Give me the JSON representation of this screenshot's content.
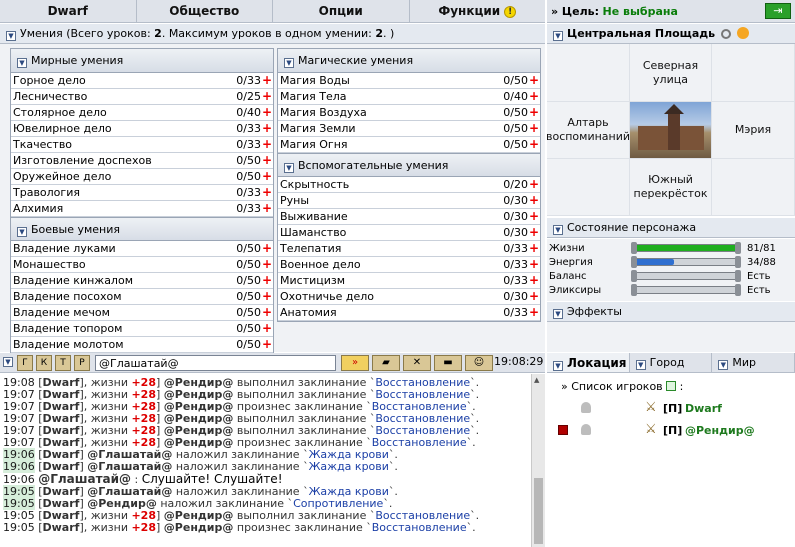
{
  "topbar": {
    "items": [
      "Dwarf",
      "Общество",
      "Опции",
      "Функции"
    ]
  },
  "goal": {
    "label": "» Цель:",
    "value": "Не выбрана"
  },
  "skills": {
    "header_prefix": "Умения (Всего уроков: ",
    "total": "2",
    "header_mid": ". Максимум уроков в одном умении: ",
    "max": "2",
    "header_suffix": ". )",
    "peace": {
      "title": "Мирные умения",
      "rows": [
        {
          "name": "Горное дело",
          "val": "0/33"
        },
        {
          "name": "Лесничество",
          "val": "0/25"
        },
        {
          "name": "Столярное дело",
          "val": "0/40"
        },
        {
          "name": "Ювелирное дело",
          "val": "0/33"
        },
        {
          "name": "Ткачество",
          "val": "0/33"
        },
        {
          "name": "Изготовление доспехов",
          "val": "0/50"
        },
        {
          "name": "Оружейное дело",
          "val": "0/50"
        },
        {
          "name": "Травология",
          "val": "0/33"
        },
        {
          "name": "Алхимия",
          "val": "0/33"
        }
      ]
    },
    "combat": {
      "title": "Боевые умения",
      "rows": [
        {
          "name": "Владение луками",
          "val": "0/50"
        },
        {
          "name": "Монашество",
          "val": "0/50"
        },
        {
          "name": "Владение кинжалом",
          "val": "0/50"
        },
        {
          "name": "Владение посохом",
          "val": "0/50"
        },
        {
          "name": "Владение мечом",
          "val": "0/50"
        },
        {
          "name": "Владение топором",
          "val": "0/50"
        },
        {
          "name": "Владение молотом",
          "val": "0/50"
        }
      ]
    },
    "magic": {
      "title": "Магические умения",
      "rows": [
        {
          "name": "Магия Воды",
          "val": "0/50"
        },
        {
          "name": "Магия Тела",
          "val": "0/40"
        },
        {
          "name": "Магия Воздуха",
          "val": "0/50"
        },
        {
          "name": "Магия Земли",
          "val": "0/50"
        },
        {
          "name": "Магия Огня",
          "val": "0/50"
        }
      ]
    },
    "aux": {
      "title": "Вспомогательные умения",
      "rows": [
        {
          "name": "Скрытность",
          "val": "0/20"
        },
        {
          "name": "Руны",
          "val": "0/30"
        },
        {
          "name": "Выживание",
          "val": "0/30"
        },
        {
          "name": "Шаманство",
          "val": "0/30"
        },
        {
          "name": "Телепатия",
          "val": "0/33"
        },
        {
          "name": "Военное дело",
          "val": "0/33"
        },
        {
          "name": "Мистицизм",
          "val": "0/33"
        },
        {
          "name": "Охотничье дело",
          "val": "0/30"
        },
        {
          "name": "Анатомия",
          "val": "0/33"
        }
      ]
    }
  },
  "location": {
    "title": "Центральная Площадь",
    "north": "Северная улица",
    "west": "Алтарь воспоминаний",
    "east": "Мэрия",
    "south": "Южный перекрёсток"
  },
  "state": {
    "title": "Состояние персонажа",
    "rows": [
      {
        "label": "Жизни",
        "value": "81/81",
        "fill": 1.0,
        "color": "#1fae1f"
      },
      {
        "label": "Энергия",
        "value": "34/88",
        "fill": 0.386,
        "color": "#2f6fd0"
      },
      {
        "label": "Баланс",
        "value": "Есть",
        "fill": 0.0,
        "color": "#999999"
      },
      {
        "label": "Эликсиры",
        "value": "Есть",
        "fill": 0.0,
        "color": "#999999"
      }
    ]
  },
  "effects": {
    "title": "Эффекты"
  },
  "chat": {
    "buttons": [
      "Г",
      "К",
      "Т",
      "Р"
    ],
    "input": "@Глашатай@",
    "time": "19:08:29",
    "lines": [
      {
        "t": "19:08",
        "pre": "[",
        "who": "Dwarf",
        "mid": "], жизни ",
        "amt": "+28",
        "mid2": "] ",
        "n2": "@Рендир@",
        "act": " выполнил заклинание `",
        "spell": "Восстановление",
        "end": "`."
      },
      {
        "t": "19:07",
        "pre": "[",
        "who": "Dwarf",
        "mid": "], жизни ",
        "amt": "+28",
        "mid2": "] ",
        "n2": "@Рендир@",
        "act": " выполнил заклинание `",
        "spell": "Восстановление",
        "end": "`."
      },
      {
        "t": "19:07",
        "pre": "[",
        "who": "Dwarf",
        "mid": "], жизни ",
        "amt": "+28",
        "mid2": "] ",
        "n2": "@Рендир@",
        "act": " произнес заклинание `",
        "spell": "Восстановление",
        "end": "`."
      },
      {
        "t": "19:07",
        "pre": "[",
        "who": "Dwarf",
        "mid": "], жизни ",
        "amt": "+28",
        "mid2": "] ",
        "n2": "@Рендир@",
        "act": " выполнил заклинание `",
        "spell": "Восстановление",
        "end": "`."
      },
      {
        "t": "19:07",
        "pre": "[",
        "who": "Dwarf",
        "mid": "], жизни ",
        "amt": "+28",
        "mid2": "] ",
        "n2": "@Рендир@",
        "act": " выполнил заклинание `",
        "spell": "Восстановление",
        "end": "`."
      },
      {
        "t": "19:07",
        "pre": "[",
        "who": "Dwarf",
        "mid": "], жизни ",
        "amt": "+28",
        "mid2": "] ",
        "n2": "@Рендир@",
        "act": " произнес заклинание `",
        "spell": "Восстановление",
        "end": "`."
      },
      {
        "t": "19:06",
        "hl": true,
        "pre": "[",
        "who": "Dwarf",
        "mid": "] ",
        "amt": "",
        "mid2": "",
        "n2": "@Глашатай@",
        "act": " наложил заклинание `",
        "spell": "Жажда крови",
        "end": "`."
      },
      {
        "t": "19:06",
        "hl": true,
        "pre": "[",
        "who": "Dwarf",
        "mid": "] ",
        "amt": "",
        "mid2": "",
        "n2": "@Глашатай@",
        "act": " наложил заклинание `",
        "spell": "Жажда крови",
        "end": "`."
      },
      {
        "t": "19:06",
        "shout": true,
        "pre": "",
        "who": "@Глашатай@",
        "mid": " : ",
        "amt": "",
        "mid2": "",
        "n2": "",
        "act": "Слушайте! Слушайте!",
        "spell": "",
        "end": ""
      },
      {
        "t": "19:05",
        "hl": true,
        "pre": "[",
        "who": "Dwarf",
        "mid": "] ",
        "amt": "",
        "mid2": "",
        "n2": "@Глашатай@",
        "act": " наложил заклинание `",
        "spell": "Жажда крови",
        "end": "`."
      },
      {
        "t": "19:05",
        "hl": true,
        "pre": "[",
        "who": "Dwarf",
        "mid": "] ",
        "amt": "",
        "mid2": "",
        "n2": "@Рендир@",
        "act": " наложил заклинание `",
        "spell": "Сопротивление",
        "end": "`."
      },
      {
        "t": "19:05",
        "pre": "[",
        "who": "Dwarf",
        "mid": "], жизни ",
        "amt": "+28",
        "mid2": "] ",
        "n2": "@Рендир@",
        "act": " выполнил заклинание `",
        "spell": "Восстановление",
        "end": "`."
      },
      {
        "t": "19:05",
        "pre": "[",
        "who": "Dwarf",
        "mid": "], жизни ",
        "amt": "+28",
        "mid2": "] ",
        "n2": "@Рендир@",
        "act": " произнес заклинание `",
        "spell": "Восстановление",
        "end": "`."
      }
    ]
  },
  "right_tabs": [
    "Локация",
    "Город",
    "Мир"
  ],
  "players": {
    "title": "» Список игроков",
    "colon": ":",
    "list": [
      {
        "clan": "[П]",
        "nick": "Dwarf",
        "flag": false
      },
      {
        "clan": "[П]",
        "nick": "@Рендир@",
        "flag": true
      }
    ]
  }
}
